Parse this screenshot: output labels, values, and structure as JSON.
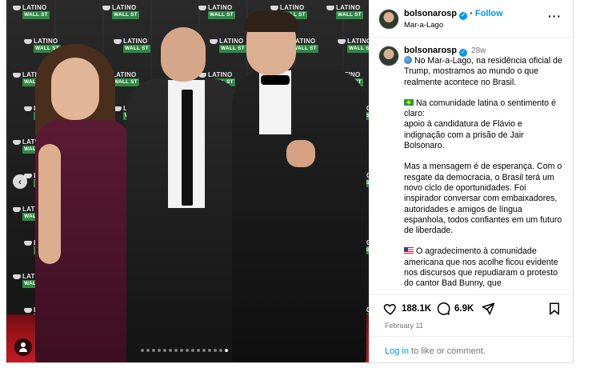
{
  "post": {
    "username": "bolsonarosp",
    "follow_label": "Follow",
    "location": "Mar-a-Lago",
    "more_icon": "more-horizontal-icon",
    "age": "28w",
    "caption_paragraphs": [
      " No Mar-a-Lago, na residência oficial de Trump, mostramos ao mundo o que realmente acontece no Brasil.",
      "Na comunidade latina o sentimento é claro:\napoio à candidatura de Flávio  e indignação com a prisão de Jair Bolsonaro.",
      "Mas a mensagem é de esperança. Com o resgate da democracia, o Brasil terá um novo ciclo de oportunidades. Foi inspirador conversar com embaixadores, autoridades e amigos de língua espanhola, todos confiantes em um futuro de liberdade.",
      "O agradecimento à comunidade americana que nos acolhe ficou evidente nos discursos que repudiaram o protesto do cantor Bad Bunny, que"
    ],
    "likes": "188.1K",
    "comments": "6.9K",
    "date": "February 11",
    "login_link": "Log in",
    "login_rest": " to like or comment."
  },
  "media": {
    "backdrop_logo": {
      "line1": "LATINO",
      "line2": "WALL ST"
    },
    "carousel_total": 16,
    "carousel_active": 15
  },
  "colors": {
    "link_blue": "#0095f6",
    "muted": "#737373",
    "carpet_red": "#c01a22",
    "logo_green": "#2f8a43"
  }
}
